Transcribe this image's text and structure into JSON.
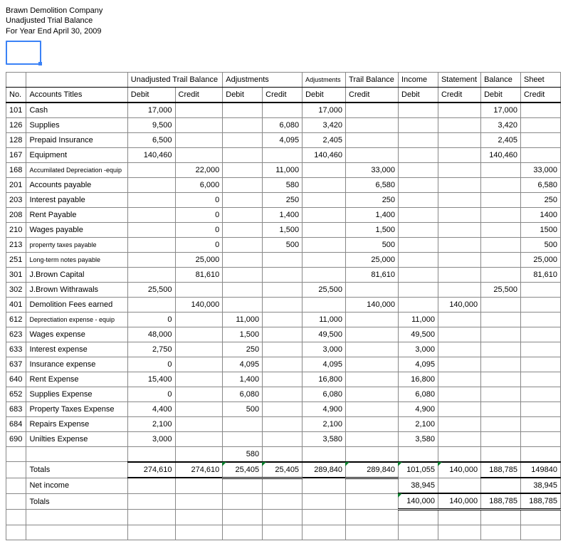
{
  "header": {
    "line1": "Brawn Demolition Company",
    "line2": "Unadjusted Trial Balance",
    "line3": "For Year End April 30, 2009"
  },
  "group_headers": {
    "g1": "Unadjusted Trail Balance",
    "g2": "Adjustments",
    "g3a": "Adjustments",
    "g3b": "Trail Balance",
    "g4a": "Income",
    "g4b": "Statement",
    "g5a": "Balance",
    "g5b": "Sheet"
  },
  "col_labels": {
    "no": "No.",
    "acct": "Accounts Titles",
    "debit": "Debit",
    "credit": "Credit"
  },
  "rows": [
    {
      "no": "101",
      "acct": "Cash",
      "utb_d": "17,000",
      "utb_c": "",
      "adj_d": "",
      "adj_c": "",
      "atb_d": "17,000",
      "atb_c": "",
      "is_d": "",
      "is_c": "",
      "bs_d": "17,000",
      "bs_c": ""
    },
    {
      "no": "126",
      "acct": "Supplies",
      "utb_d": "9,500",
      "utb_c": "",
      "adj_d": "",
      "adj_c": "6,080",
      "atb_d": "3,420",
      "atb_c": "",
      "is_d": "",
      "is_c": "",
      "bs_d": "3,420",
      "bs_c": ""
    },
    {
      "no": "128",
      "acct": "Prepaid Insurance",
      "utb_d": "6,500",
      "utb_c": "",
      "adj_d": "",
      "adj_c": "4,095",
      "atb_d": "2,405",
      "atb_c": "",
      "is_d": "",
      "is_c": "",
      "bs_d": "2,405",
      "bs_c": ""
    },
    {
      "no": "167",
      "acct": "Equipment",
      "utb_d": "140,460",
      "utb_c": "",
      "adj_d": "",
      "adj_c": "",
      "atb_d": "140,460",
      "atb_c": "",
      "is_d": "",
      "is_c": "",
      "bs_d": "140,460",
      "bs_c": ""
    },
    {
      "no": "168",
      "acct": "Accumilated Depreciation -equip",
      "utb_d": "",
      "utb_c": "22,000",
      "adj_d": "",
      "adj_c": "11,000",
      "atb_d": "",
      "atb_c": "33,000",
      "is_d": "",
      "is_c": "",
      "bs_d": "",
      "bs_c": "33,000"
    },
    {
      "no": "201",
      "acct": "Accounts payable",
      "utb_d": "",
      "utb_c": "6,000",
      "adj_d": "",
      "adj_c": "580",
      "atb_d": "",
      "atb_c": "6,580",
      "is_d": "",
      "is_c": "",
      "bs_d": "",
      "bs_c": "6,580"
    },
    {
      "no": "203",
      "acct": "Interest payable",
      "utb_d": "",
      "utb_c": "0",
      "adj_d": "",
      "adj_c": "250",
      "atb_d": "",
      "atb_c": "250",
      "is_d": "",
      "is_c": "",
      "bs_d": "",
      "bs_c": "250"
    },
    {
      "no": "208",
      "acct": "Rent Payable",
      "utb_d": "",
      "utb_c": "0",
      "adj_d": "",
      "adj_c": "1,400",
      "atb_d": "",
      "atb_c": "1,400",
      "is_d": "",
      "is_c": "",
      "bs_d": "",
      "bs_c": "1400"
    },
    {
      "no": "210",
      "acct": "Wages payable",
      "utb_d": "",
      "utb_c": "0",
      "adj_d": "",
      "adj_c": "1,500",
      "atb_d": "",
      "atb_c": "1,500",
      "is_d": "",
      "is_c": "",
      "bs_d": "",
      "bs_c": "1500"
    },
    {
      "no": "213",
      "acct": "properrty taxes payable",
      "utb_d": "",
      "utb_c": "0",
      "adj_d": "",
      "adj_c": "500",
      "atb_d": "",
      "atb_c": "500",
      "is_d": "",
      "is_c": "",
      "bs_d": "",
      "bs_c": "500"
    },
    {
      "no": "251",
      "acct": "Long-term notes payable",
      "utb_d": "",
      "utb_c": "25,000",
      "adj_d": "",
      "adj_c": "",
      "atb_d": "",
      "atb_c": "25,000",
      "is_d": "",
      "is_c": "",
      "bs_d": "",
      "bs_c": "25,000"
    },
    {
      "no": "301",
      "acct": "J.Brown Capital",
      "utb_d": "",
      "utb_c": "81,610",
      "adj_d": "",
      "adj_c": "",
      "atb_d": "",
      "atb_c": "81,610",
      "is_d": "",
      "is_c": "",
      "bs_d": "",
      "bs_c": "81,610"
    },
    {
      "no": "302",
      "acct": "J.Brown Withrawals",
      "utb_d": "25,500",
      "utb_c": "",
      "adj_d": "",
      "adj_c": "",
      "atb_d": "25,500",
      "atb_c": "",
      "is_d": "",
      "is_c": "",
      "bs_d": "25,500",
      "bs_c": ""
    },
    {
      "no": "401",
      "acct": "Demolition Fees earned",
      "utb_d": "",
      "utb_c": "140,000",
      "adj_d": "",
      "adj_c": "",
      "atb_d": "",
      "atb_c": "140,000",
      "is_d": "",
      "is_c": "140,000",
      "bs_d": "",
      "bs_c": ""
    },
    {
      "no": "612",
      "acct": "Deprectiation expense - equip",
      "utb_d": "0",
      "utb_c": "",
      "adj_d": "11,000",
      "adj_c": "",
      "atb_d": "11,000",
      "atb_c": "",
      "is_d": "11,000",
      "is_c": "",
      "bs_d": "",
      "bs_c": ""
    },
    {
      "no": "623",
      "acct": "Wages expense",
      "utb_d": "48,000",
      "utb_c": "",
      "adj_d": "1,500",
      "adj_c": "",
      "atb_d": "49,500",
      "atb_c": "",
      "is_d": "49,500",
      "is_c": "",
      "bs_d": "",
      "bs_c": ""
    },
    {
      "no": "633",
      "acct": "Interest expense",
      "utb_d": "2,750",
      "utb_c": "",
      "adj_d": "250",
      "adj_c": "",
      "atb_d": "3,000",
      "atb_c": "",
      "is_d": "3,000",
      "is_c": "",
      "bs_d": "",
      "bs_c": ""
    },
    {
      "no": "637",
      "acct": "Insurance expense",
      "utb_d": "0",
      "utb_c": "",
      "adj_d": "4,095",
      "adj_c": "",
      "atb_d": "4,095",
      "atb_c": "",
      "is_d": "4,095",
      "is_c": "",
      "bs_d": "",
      "bs_c": ""
    },
    {
      "no": "640",
      "acct": "Rent Expense",
      "utb_d": "15,400",
      "utb_c": "",
      "adj_d": "1,400",
      "adj_c": "",
      "atb_d": "16,800",
      "atb_c": "",
      "is_d": "16,800",
      "is_c": "",
      "bs_d": "",
      "bs_c": ""
    },
    {
      "no": "652",
      "acct": "Supplies Expense",
      "utb_d": "0",
      "utb_c": "",
      "adj_d": "6,080",
      "adj_c": "",
      "atb_d": "6,080",
      "atb_c": "",
      "is_d": "6,080",
      "is_c": "",
      "bs_d": "",
      "bs_c": ""
    },
    {
      "no": "683",
      "acct": "Property Taxes Expense",
      "utb_d": "4,400",
      "utb_c": "",
      "adj_d": "500",
      "adj_c": "",
      "atb_d": "4,900",
      "atb_c": "",
      "is_d": "4,900",
      "is_c": "",
      "bs_d": "",
      "bs_c": ""
    },
    {
      "no": "684",
      "acct": "Repairs Expense",
      "utb_d": "2,100",
      "utb_c": "",
      "adj_d": "",
      "adj_c": "",
      "atb_d": "2,100",
      "atb_c": "",
      "is_d": "2,100",
      "is_c": "",
      "bs_d": "",
      "bs_c": ""
    },
    {
      "no": "690",
      "acct": "Unilties Expense",
      "utb_d": "3,000",
      "utb_c": "",
      "adj_d": "",
      "adj_c": "",
      "atb_d": "3,580",
      "atb_c": "",
      "is_d": "3,580",
      "is_c": "",
      "bs_d": "",
      "bs_c": ""
    }
  ],
  "extra_adj_d": "580",
  "totals": {
    "label": "Totals",
    "utb_d": "274,610",
    "utb_c": "274,610",
    "adj_d": "25,405",
    "adj_c": "25,405",
    "atb_d": "289,840",
    "atb_c": "289,840",
    "is_d": "101,055",
    "is_c": "140,000",
    "bs_d": "188,785",
    "bs_c": "149840"
  },
  "net_income": {
    "label": "Net income",
    "is_d": "38,945",
    "bs_c": "38,945"
  },
  "final_totals": {
    "label": "Tolals",
    "is_d": "140,000",
    "is_c": "140,000",
    "bs_d": "188,785",
    "bs_c": "188,785"
  },
  "chart_data": {
    "type": "table",
    "title": "Brawn Demolition Company — Unadjusted Trial Balance Worksheet, Year End April 30, 2009",
    "columns": [
      "No.",
      "Accounts Titles",
      "Unadj TB Debit",
      "Unadj TB Credit",
      "Adj Debit",
      "Adj Credit",
      "Adj TB Debit",
      "Adj TB Credit",
      "IS Debit",
      "IS Credit",
      "BS Debit",
      "BS Credit"
    ]
  }
}
